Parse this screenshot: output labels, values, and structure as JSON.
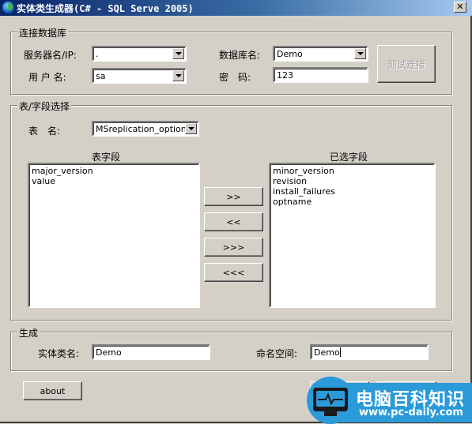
{
  "window": {
    "title": "实体类生成器(C# - SQL Serve 2005)",
    "close_glyph": "✕"
  },
  "connection": {
    "legend": "连接数据库",
    "server_label": "服务器名/IP:",
    "server_value": ".",
    "user_label": "用 户 名:",
    "user_value": "sa",
    "database_label": "数据库名:",
    "database_value": "Demo",
    "password_label": "密　码:",
    "password_value": "123",
    "test_button": "测试连接"
  },
  "fields": {
    "legend": "表/字段选择",
    "table_label": "表　名:",
    "table_value": "MSreplication_options",
    "table_fields_header": "表字段",
    "table_fields": [
      "major_version",
      "value"
    ],
    "selected_fields_header": "已选字段",
    "selected_fields": [
      "minor_version",
      "revision",
      "install_failures",
      "optname"
    ],
    "add_button": ">>",
    "remove_button": "<<",
    "add_all_button": ">>>",
    "remove_all_button": "<<<"
  },
  "generate": {
    "legend": "生成",
    "class_label": "实体类名:",
    "class_value": "Demo",
    "namespace_label": "命名空间:",
    "namespace_value": "Demo"
  },
  "footer": {
    "about_button": "about"
  },
  "watermark": {
    "title": "电脑百科知识",
    "url": "www.pc-daily.com"
  }
}
